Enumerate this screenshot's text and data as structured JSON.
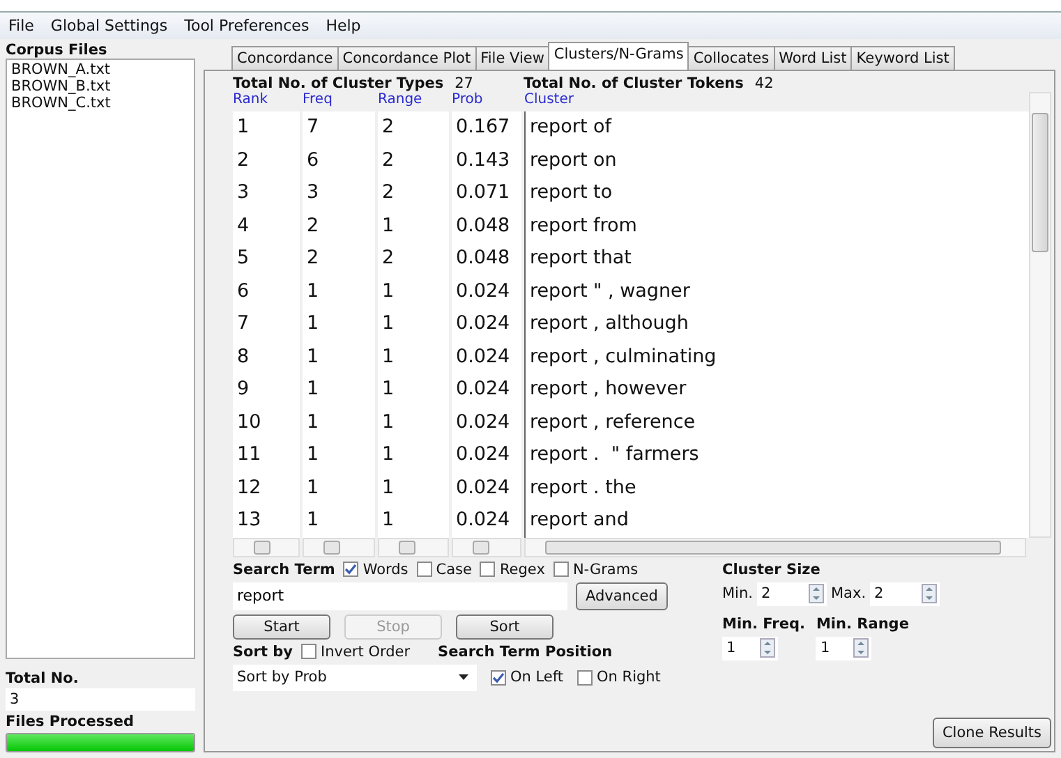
{
  "menu": [
    "File",
    "Global Settings",
    "Tool Preferences",
    "Help"
  ],
  "corpus_files": {
    "title": "Corpus Files",
    "files": [
      "BROWN_A.txt",
      "BROWN_B.txt",
      "BROWN_C.txt"
    ]
  },
  "total": {
    "label": "Total No.",
    "value": "3"
  },
  "files_processed": {
    "label": "Files Processed",
    "level": 1
  },
  "tabs": [
    {
      "label": "Concordance",
      "selected": false
    },
    {
      "label": "Concordance Plot",
      "selected": false
    },
    {
      "label": "File View",
      "selected": false
    },
    {
      "label": "Clusters/N-Grams",
      "selected": true
    },
    {
      "label": "Collocates",
      "selected": false
    },
    {
      "label": "Word List",
      "selected": false
    },
    {
      "label": "Keyword List",
      "selected": false
    }
  ],
  "summary": {
    "types_label": "Total No. of Cluster Types",
    "types_value": "27",
    "tokens_label": "Total No. of Cluster Tokens",
    "tokens_value": "42"
  },
  "table": {
    "columns": [
      "Rank",
      "Freq",
      "Range",
      "Prob",
      "Cluster"
    ],
    "rows": [
      [
        "1",
        "7",
        "2",
        "0.167",
        "report of"
      ],
      [
        "2",
        "6",
        "2",
        "0.143",
        "report on"
      ],
      [
        "3",
        "3",
        "2",
        "0.071",
        "report to"
      ],
      [
        "4",
        "2",
        "1",
        "0.048",
        "report from"
      ],
      [
        "5",
        "2",
        "2",
        "0.048",
        "report that"
      ],
      [
        "6",
        "1",
        "1",
        "0.024",
        "report \" , wagner"
      ],
      [
        "7",
        "1",
        "1",
        "0.024",
        "report , although"
      ],
      [
        "8",
        "1",
        "1",
        "0.024",
        "report , culminating"
      ],
      [
        "9",
        "1",
        "1",
        "0.024",
        "report , however"
      ],
      [
        "10",
        "1",
        "1",
        "0.024",
        "report , reference"
      ],
      [
        "11",
        "1",
        "1",
        "0.024",
        "report .  \" farmers"
      ],
      [
        "12",
        "1",
        "1",
        "0.024",
        "report . the"
      ],
      [
        "13",
        "1",
        "1",
        "0.024",
        "report and"
      ]
    ]
  },
  "search": {
    "label": "Search Term",
    "options": [
      {
        "label": "Words",
        "checked": true
      },
      {
        "label": "Case",
        "checked": false
      },
      {
        "label": "Regex",
        "checked": false
      },
      {
        "label": "N-Grams",
        "checked": false
      }
    ],
    "value": "report",
    "advanced": "Advanced"
  },
  "actions": [
    {
      "label": "Start",
      "disabled": false
    },
    {
      "label": "Stop",
      "disabled": true
    },
    {
      "label": "Sort",
      "disabled": false
    }
  ],
  "sort_by": {
    "label": "Sort by",
    "invert": {
      "label": "Invert Order",
      "checked": false
    },
    "value": "Sort by Prob"
  },
  "position": {
    "label": "Search Term Position",
    "options": [
      {
        "label": "On Left",
        "checked": true
      },
      {
        "label": "On Right",
        "checked": false
      }
    ]
  },
  "cluster_size": {
    "label": "Cluster Size",
    "min_label": "Min.",
    "min": "2",
    "max_label": "Max.",
    "max": "2"
  },
  "thresholds": [
    {
      "label": "Min. Freq.",
      "value": "1"
    },
    {
      "label": "Min. Range",
      "value": "1"
    }
  ],
  "clone": "Clone Results"
}
